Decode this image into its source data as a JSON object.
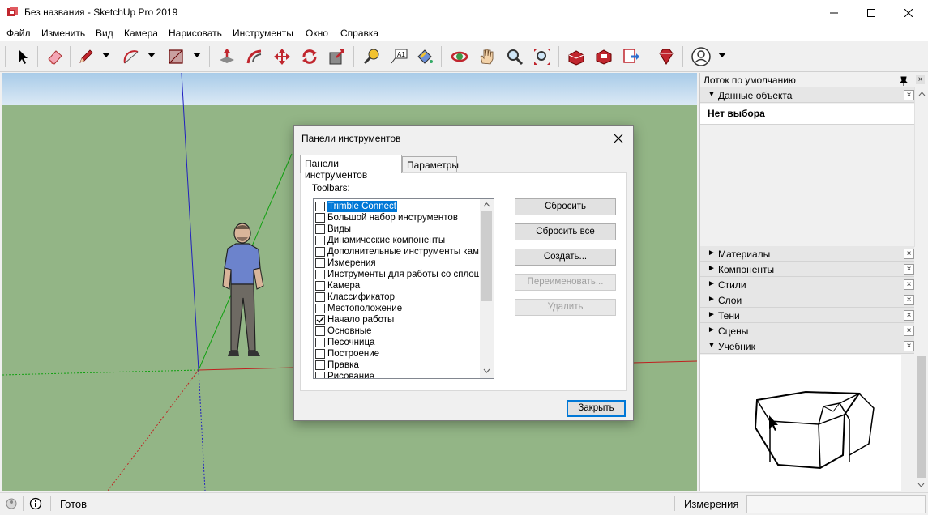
{
  "window": {
    "title": "Без названия - SketchUp Pro 2019",
    "accent_color": "#c0262e"
  },
  "menu": [
    "Файл",
    "Изменить",
    "Вид",
    "Камера",
    "Нарисовать",
    "Инструменты",
    "Окно",
    "Справка"
  ],
  "toolbar": {
    "icons": [
      "select-icon",
      "eraser-icon",
      "pencil-icon",
      "arc-icon",
      "rectangle-icon",
      "push-pull-icon",
      "follow-me-icon",
      "move-icon",
      "rotate-icon",
      "scale-icon",
      "tape-measure-icon",
      "text-icon",
      "paint-bucket-icon",
      "orbit-icon",
      "pan-icon",
      "zoom-icon",
      "zoom-extents-icon",
      "warehouse-icon",
      "extension-warehouse-icon",
      "layout-icon",
      "extension-manager-icon",
      "account-icon"
    ]
  },
  "tray": {
    "title": "Лоток по умолчанию",
    "entity_info": {
      "label": "Данные объекта",
      "status": "Нет выбора"
    },
    "panels": [
      {
        "label": "Материалы",
        "expanded": false
      },
      {
        "label": "Компоненты",
        "expanded": false
      },
      {
        "label": "Стили",
        "expanded": false
      },
      {
        "label": "Слои",
        "expanded": false
      },
      {
        "label": "Тени",
        "expanded": false
      },
      {
        "label": "Сцены",
        "expanded": false
      },
      {
        "label": "Учебник",
        "expanded": true
      }
    ],
    "arrow_collapsed": "►",
    "arrow_expanded": "▼",
    "close_glyph": "×"
  },
  "dialog": {
    "title": "Панели инструментов",
    "tabs": [
      "Панели инструментов",
      "Параметры"
    ],
    "list_label": "Toolbars:",
    "toolbars": [
      {
        "name": "Trimble Connect",
        "checked": false,
        "selected": true
      },
      {
        "name": "Большой набор инструментов",
        "checked": false
      },
      {
        "name": "Виды",
        "checked": false
      },
      {
        "name": "Динамические компоненты",
        "checked": false
      },
      {
        "name": "Дополнительные инструменты камеры",
        "checked": false
      },
      {
        "name": "Измерения",
        "checked": false
      },
      {
        "name": "Инструменты для работы со сплошными телами",
        "checked": false
      },
      {
        "name": "Камера",
        "checked": false
      },
      {
        "name": "Классификатор",
        "checked": false
      },
      {
        "name": "Местоположение",
        "checked": false
      },
      {
        "name": "Начало работы",
        "checked": true
      },
      {
        "name": "Основные",
        "checked": false
      },
      {
        "name": "Песочница",
        "checked": false
      },
      {
        "name": "Построение",
        "checked": false
      },
      {
        "name": "Правка",
        "checked": false
      },
      {
        "name": "Рисование",
        "checked": false
      }
    ],
    "buttons": {
      "reset": "Сбросить",
      "reset_all": "Сбросить все",
      "create": "Создать...",
      "rename": "Переименовать...",
      "delete": "Удалить",
      "close": "Закрыть"
    }
  },
  "status": {
    "text": "Готов",
    "measurements_label": "Измерения",
    "measurements_value": ""
  }
}
